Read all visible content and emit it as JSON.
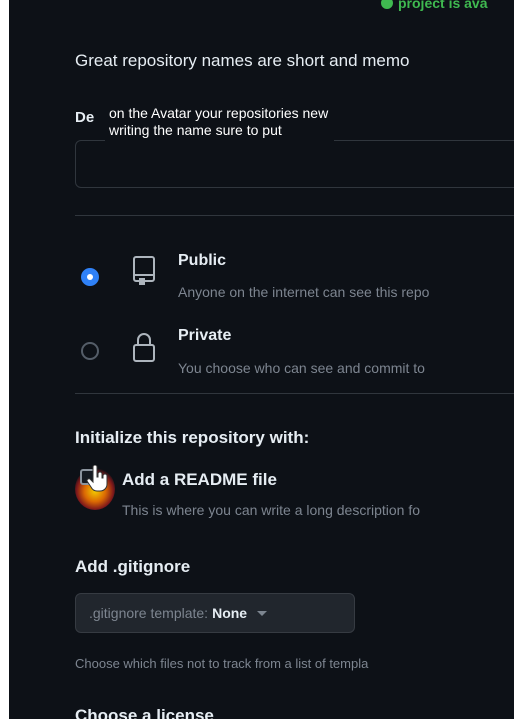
{
  "status": {
    "text": "project is ava"
  },
  "intro": {
    "text": "Great repository names are short and memo"
  },
  "description": {
    "label": "De",
    "overlay_line1": "on the Avatar your repositories new",
    "overlay_line2": "writing the name sure to put",
    "value": ""
  },
  "visibility": {
    "options": [
      {
        "title": "Public",
        "desc": "Anyone on the internet can see this repo",
        "selected": true
      },
      {
        "title": "Private",
        "desc": "You choose who can see and commit to",
        "selected": false
      }
    ]
  },
  "init": {
    "title": "Initialize this repository with:",
    "readme_title": "Add a README file",
    "readme_desc": "This is where you can write a long description fo",
    "readme_checked": false
  },
  "gitignore": {
    "title": "Add .gitignore",
    "button_prefix": ".gitignore template:",
    "button_value": "None",
    "hint": "Choose which files not to track from a list of templa"
  },
  "license": {
    "title": "Choose a license"
  },
  "colors": {
    "accent": "#2f81f7",
    "success": "#3fb950",
    "background": "#0d1117"
  }
}
